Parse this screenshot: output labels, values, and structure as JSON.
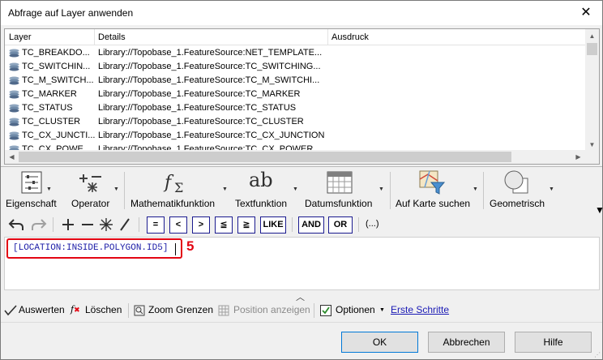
{
  "window": {
    "title": "Abfrage auf Layer anwenden"
  },
  "grid": {
    "columns": [
      "Layer",
      "Details",
      "Ausdruck"
    ],
    "rows": [
      {
        "layer": "TC_BREAKDO...",
        "details": "Library://Topobase_1.FeatureSource:NET_TEMPLATE..."
      },
      {
        "layer": "TC_SWITCHIN...",
        "details": "Library://Topobase_1.FeatureSource:TC_SWITCHING..."
      },
      {
        "layer": "TC_M_SWITCH...",
        "details": "Library://Topobase_1.FeatureSource:TC_M_SWITCHI..."
      },
      {
        "layer": "TC_MARKER",
        "details": "Library://Topobase_1.FeatureSource:TC_MARKER"
      },
      {
        "layer": "TC_STATUS",
        "details": "Library://Topobase_1.FeatureSource:TC_STATUS"
      },
      {
        "layer": "TC_CLUSTER",
        "details": "Library://Topobase_1.FeatureSource:TC_CLUSTER"
      },
      {
        "layer": "TC_CX_JUNCTI...",
        "details": "Library://Topobase_1.FeatureSource:TC_CX_JUNCTION"
      },
      {
        "layer": "TC_CX_POWE...",
        "details": "Library://Topobase_1.FeatureSource:TC_CX_POWER"
      }
    ]
  },
  "ribbon": {
    "eigenschaft": "Eigenschaft",
    "operator": "Operator",
    "mathematik": "Mathematikfunktion",
    "text": "Textfunktion",
    "datum": "Datumsfunktion",
    "karte": "Auf Karte suchen",
    "geometrisch": "Geometrisch",
    "text_icon": "ab"
  },
  "operators": {
    "eq": "=",
    "lt": "<",
    "gt": ">",
    "le": "≦",
    "ge": "≧",
    "like": "LIKE",
    "and": "AND",
    "or": "OR",
    "ellipsis": "(...)"
  },
  "editor": {
    "expression": "[LOCATION:INSIDE.POLYGON.ID5]",
    "marker": "5"
  },
  "statusbar": {
    "auswerten": "Auswerten",
    "loeschen": "Löschen",
    "zoom": "Zoom Grenzen",
    "position": "Position anzeigen",
    "optionen": "Optionen",
    "erste": "Erste Schritte"
  },
  "buttons": {
    "ok": "OK",
    "cancel": "Abbrechen",
    "help": "Hilfe"
  },
  "colors": {
    "accent": "#0078d7",
    "highlight": "#e30613",
    "expression": "#1a1aa6"
  }
}
